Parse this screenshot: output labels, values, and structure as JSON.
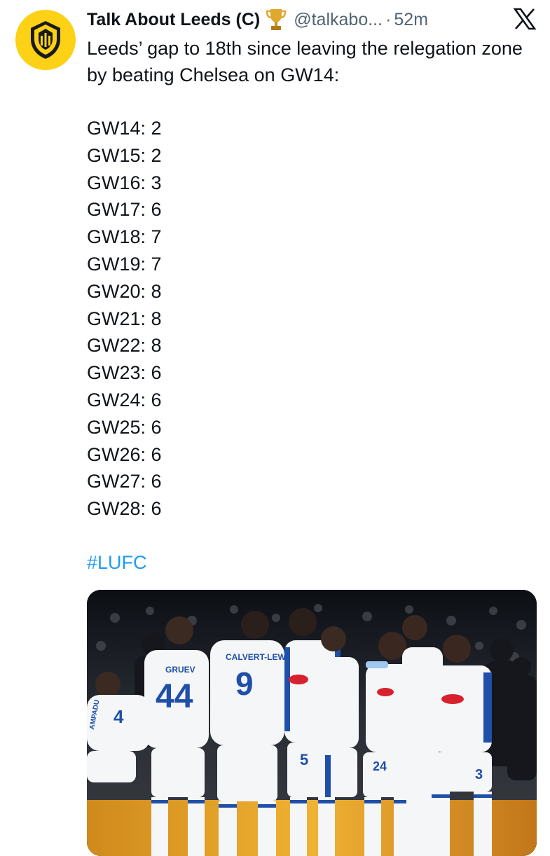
{
  "tweet": {
    "author": {
      "display_name": "Talk About Leeds (C)",
      "badge_icon": "trophy-icon",
      "handle": "@talkabo...",
      "avatar_color": "#fcd116"
    },
    "separator": "·",
    "timestamp": "52m",
    "platform_icon": "x-logo-icon",
    "text": "Leeds’ gap to 18th since leaving the relegation zone by beating Chelsea on GW14:",
    "stats": [
      "GW14: 2",
      "GW15: 2",
      "GW16: 3",
      "GW17: 6",
      "GW18: 7",
      "GW19: 7",
      "GW20: 8",
      "GW21: 8",
      "GW22: 8",
      "GW23: 6",
      "GW24: 6",
      "GW25: 6",
      "GW26: 6",
      "GW27: 6",
      "GW28: 6"
    ],
    "hashtag": "#LUFC",
    "hashtag_color": "#1d9bf0",
    "media": {
      "players": [
        {
          "name": "GRUEV",
          "number": "44"
        },
        {
          "name": "CALVERT-LEWIN",
          "number": "9"
        },
        {
          "name": "",
          "number": "5"
        },
        {
          "name": "",
          "number": "24"
        },
        {
          "name": "",
          "number": "3"
        },
        {
          "name": "AMPADU",
          "number": "4"
        }
      ],
      "kit_color": "#f4f6f8",
      "trim_color": "#1f4fa8",
      "sponsor_color": "#d8202f"
    }
  }
}
